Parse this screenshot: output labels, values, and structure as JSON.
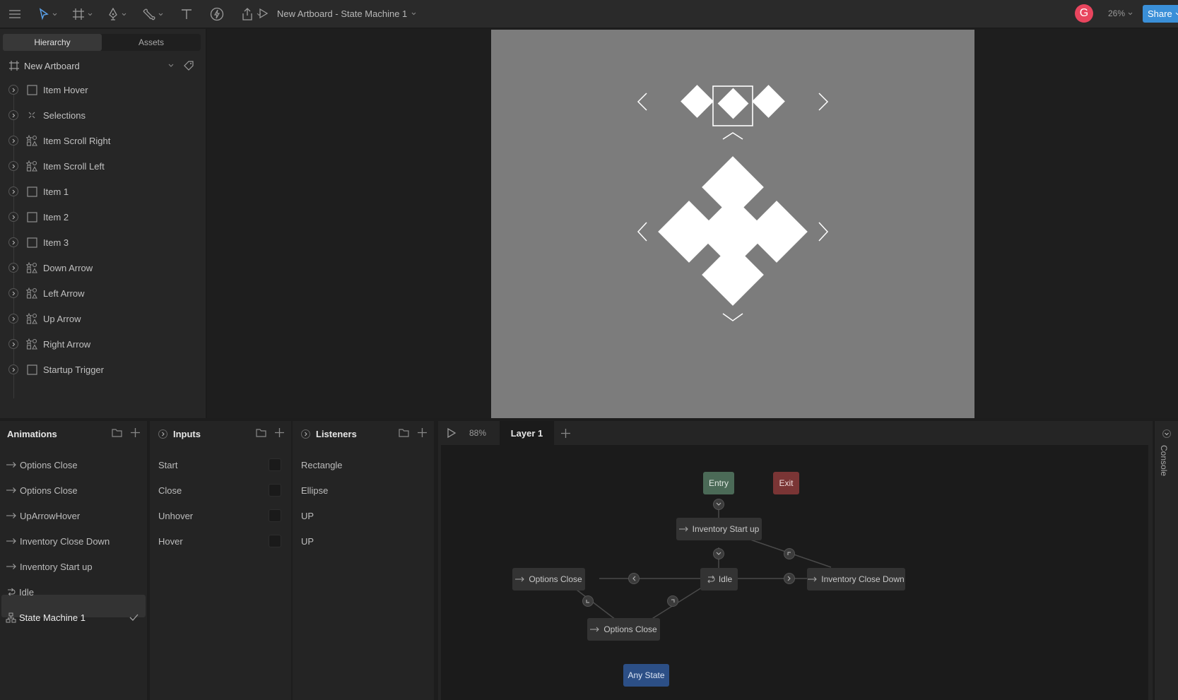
{
  "toolbar": {
    "doc_title": "New Artboard - State Machine 1",
    "zoom": "26%",
    "share_label": "Share",
    "avatar_letter": "G"
  },
  "hierarchy": {
    "tabs": [
      {
        "label": "Hierarchy",
        "active": true
      },
      {
        "label": "Assets",
        "active": false
      }
    ],
    "artboard_name": "New Artboard",
    "items": [
      {
        "label": "Item Hover",
        "icon": "square-icon"
      },
      {
        "label": "Selections",
        "icon": "group-icon"
      },
      {
        "label": "Item Scroll Right",
        "icon": "shapes-icon"
      },
      {
        "label": "Item Scroll Left",
        "icon": "shapes-icon"
      },
      {
        "label": "Item 1",
        "icon": "square-icon"
      },
      {
        "label": "Item 2",
        "icon": "square-icon"
      },
      {
        "label": "Item 3",
        "icon": "square-icon"
      },
      {
        "label": "Down Arrow",
        "icon": "shapes-icon"
      },
      {
        "label": "Left Arrow",
        "icon": "shapes-icon"
      },
      {
        "label": "Up Arrow",
        "icon": "shapes-icon"
      },
      {
        "label": "Right Arrow",
        "icon": "shapes-icon"
      },
      {
        "label": "Startup Trigger",
        "icon": "square-icon"
      }
    ]
  },
  "animations": {
    "title": "Animations",
    "items": [
      {
        "label": "Options Close",
        "icon": "arrow-right-icon"
      },
      {
        "label": "Options Close",
        "icon": "arrow-right-icon"
      },
      {
        "label": "UpArrowHover",
        "icon": "arrow-right-icon"
      },
      {
        "label": "Inventory Close Down",
        "icon": "arrow-right-icon"
      },
      {
        "label": "Inventory Start up",
        "icon": "arrow-right-icon"
      },
      {
        "label": "Idle",
        "icon": "loop-icon"
      },
      {
        "label": "State Machine 1",
        "icon": "state-machine-icon",
        "selected": true
      }
    ]
  },
  "inputs": {
    "title": "Inputs",
    "items": [
      {
        "label": "Start"
      },
      {
        "label": "Close"
      },
      {
        "label": "Unhover"
      },
      {
        "label": "Hover"
      }
    ]
  },
  "listeners": {
    "title": "Listeners",
    "items": [
      {
        "label": "Rectangle"
      },
      {
        "label": "Ellipse"
      },
      {
        "label": "UP"
      },
      {
        "label": "UP"
      }
    ]
  },
  "graph": {
    "zoom": "88%",
    "layer_tab": "Layer 1",
    "nodes": {
      "entry": "Entry",
      "exit": "Exit",
      "inventory_start": "Inventory Start up",
      "idle": "Idle",
      "options_close_left": "Options Close",
      "inventory_close_down": "Inventory Close Down",
      "options_close_bottom": "Options Close",
      "any_state": "Any State"
    }
  },
  "console": {
    "label": "Console"
  },
  "colors": {
    "accent_share": "#3a8fd8",
    "avatar": "#e8455e",
    "entry": "#4b6a57",
    "exit": "#7a3535",
    "any_state": "#2c4f86",
    "artboard": "#7c7c7c"
  }
}
